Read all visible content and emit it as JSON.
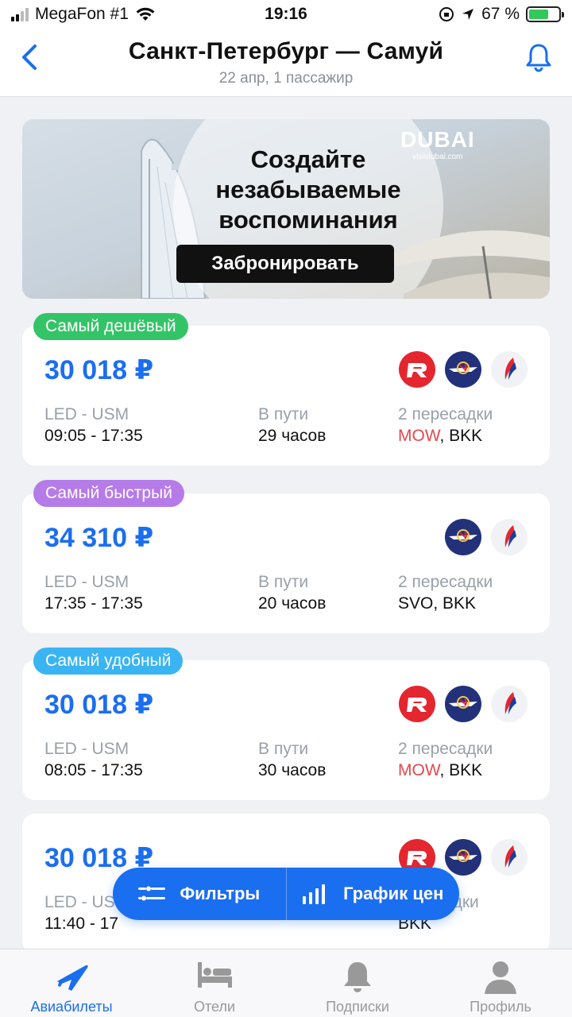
{
  "status_bar": {
    "carrier": "MegaFon #1",
    "time": "19:16",
    "battery": "67 %",
    "battery_level": 0.67
  },
  "header": {
    "title": "Санкт-Петербург — Самуй",
    "subtitle": "22 апр, 1 пассажир"
  },
  "banner": {
    "logo": "DUBAI",
    "logo_sub": "visitdubai.com",
    "headline_1": "Создайте",
    "headline_2": "незабываемые",
    "headline_3": "воспоминания",
    "cta": "Забронировать"
  },
  "labels": {
    "duration": "В пути"
  },
  "offers": [
    {
      "badge": "Самый дешёвый",
      "badge_color": "#34c468",
      "price": "30 018 ₽",
      "route": "LED - USM",
      "times": "09:05 - 17:35",
      "duration": "29 часов",
      "stops": "2 пересадки",
      "via_1": "MOW",
      "via_rest": ", BKK",
      "airlines": [
        "r-logo-icon",
        "aeroflot-icon",
        "rossiya-icon"
      ]
    },
    {
      "badge": "Самый быстрый",
      "badge_color": "#b57be8",
      "price": "34 310 ₽",
      "route": "LED - USM",
      "times": "17:35 - 17:35",
      "duration": "20 часов",
      "stops": "2 пересадки",
      "via_1": "SVO",
      "via_rest": ", BKK",
      "airlines": [
        "aeroflot-icon",
        "rossiya-icon"
      ]
    },
    {
      "badge": "Самый удобный",
      "badge_color": "#3ab4f2",
      "price": "30 018 ₽",
      "route": "LED - USM",
      "times": "08:05 - 17:35",
      "duration": "30 часов",
      "stops": "2 пересадки",
      "via_1": "MOW",
      "via_rest": ", BKK",
      "airlines": [
        "r-logo-icon",
        "aeroflot-icon",
        "rossiya-icon"
      ]
    },
    {
      "price": "30 018 ₽",
      "route": "LED - USM",
      "times": "11:40 - 17",
      "stops": "пересадки",
      "via_rest": "BKK",
      "airlines": [
        "r-logo-icon",
        "aeroflot-icon",
        "rossiya-icon"
      ]
    }
  ],
  "floating": {
    "filters": "Фильтры",
    "chart": "График цен"
  },
  "tabs": [
    {
      "label": "Авиабилеты",
      "icon": "plane-icon",
      "active": true
    },
    {
      "label": "Отели",
      "icon": "bed-icon"
    },
    {
      "label": "Подписки",
      "icon": "bell-icon"
    },
    {
      "label": "Профиль",
      "icon": "person-icon"
    }
  ],
  "colors": {
    "accent": "#1a6ef0",
    "transfer_highlight": "#e5484d"
  }
}
